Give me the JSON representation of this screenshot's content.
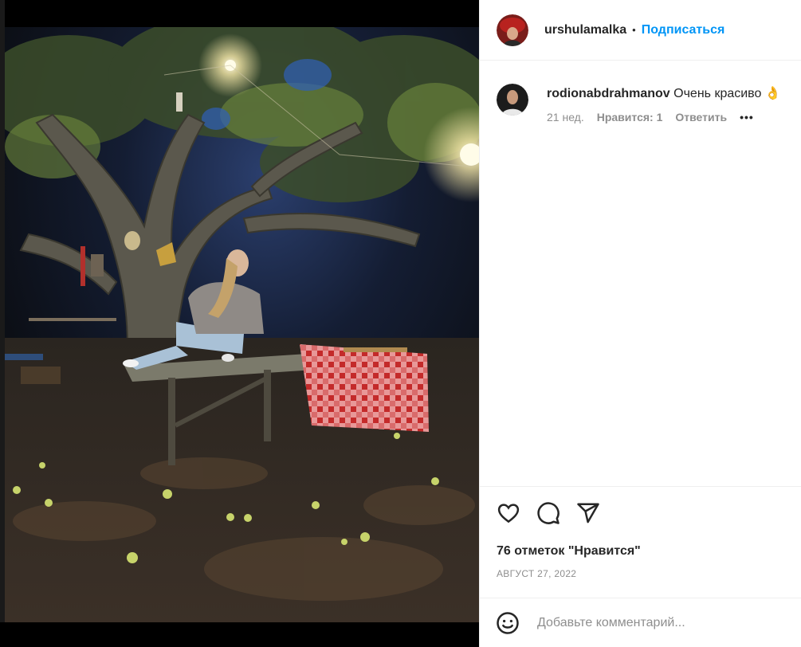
{
  "post": {
    "username": "urshulamalka",
    "separator": "•",
    "follow_label": "Подписаться"
  },
  "comment": {
    "username": "rodionabdrahmanov",
    "text": "Очень красиво",
    "emoji": "👌",
    "age": "21 нед.",
    "likes_label": "Нравится: 1",
    "reply_label": "Ответить",
    "more_label": "•••"
  },
  "actions": {
    "likes_count": "76 отметок \"Нравится\"",
    "date": "АВГУСТ 27, 2022"
  },
  "add_comment": {
    "placeholder": "Добавьте комментарий..."
  },
  "icons": {
    "like": "heart-icon",
    "comment": "comment-bubble-icon",
    "share": "paper-plane-icon",
    "emoji": "smiley-icon"
  }
}
